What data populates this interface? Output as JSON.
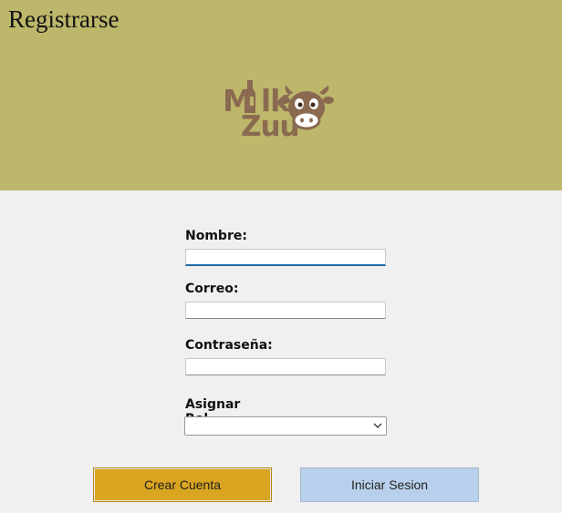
{
  "header": {
    "title": "Registrarse",
    "logo": {
      "line1": "Milk",
      "line2": "Zuu",
      "icon": "cow-icon"
    },
    "background_color": "#bdb76b"
  },
  "form": {
    "nombre_label": "Nombre:",
    "nombre_value": "",
    "correo_label": "Correo:",
    "correo_value": "",
    "contrasena_label": "Contraseña:",
    "contrasena_value": "",
    "rol_label": "Asignar Rol",
    "rol_selected": ""
  },
  "buttons": {
    "create_label": "Crear Cuenta",
    "create_color": "#daa520",
    "login_label": "Iniciar Sesion",
    "login_color": "#b8d0ec"
  }
}
